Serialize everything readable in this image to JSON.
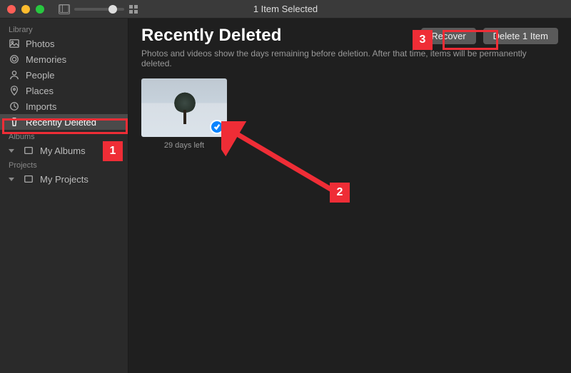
{
  "titlebar": {
    "title": "1 Item Selected"
  },
  "sidebar": {
    "sections": {
      "library": {
        "label": "Library",
        "items": [
          {
            "label": "Photos"
          },
          {
            "label": "Memories"
          },
          {
            "label": "People"
          },
          {
            "label": "Places"
          },
          {
            "label": "Imports"
          },
          {
            "label": "Recently Deleted"
          }
        ]
      },
      "albums": {
        "label": "Albums",
        "my_albums_label": "My Albums"
      },
      "projects": {
        "label": "Projects",
        "my_projects_label": "My Projects"
      }
    }
  },
  "main": {
    "page_title": "Recently Deleted",
    "recover_label": "Recover",
    "delete_label": "Delete 1 Item",
    "subtitle": "Photos and videos show the days remaining before deletion. After that time, items will be permanently deleted.",
    "items": [
      {
        "caption": "29 days left",
        "selected": true
      }
    ]
  },
  "annotations": {
    "n1": "1",
    "n2": "2",
    "n3": "3"
  }
}
